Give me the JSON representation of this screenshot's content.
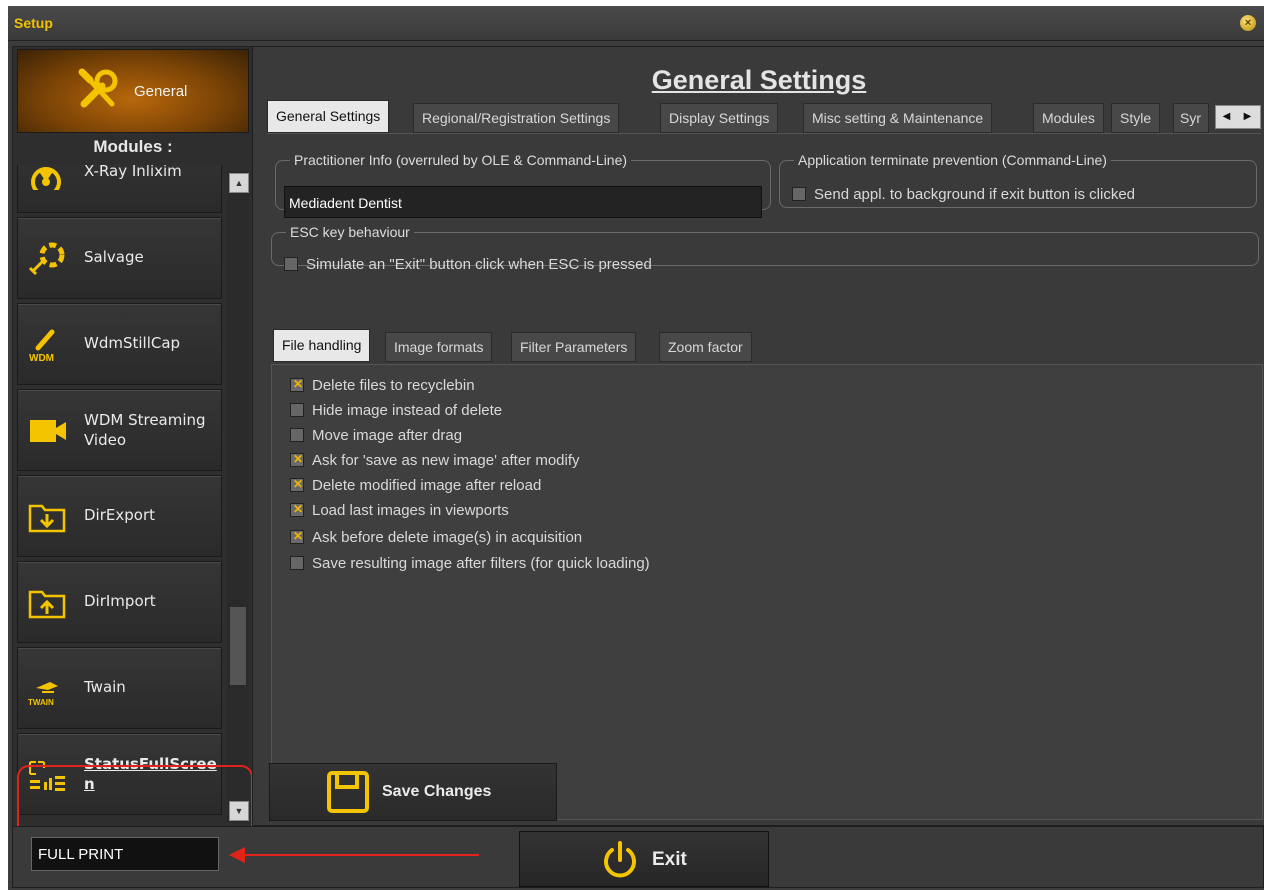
{
  "window": {
    "title": "Setup"
  },
  "sidebar": {
    "top_button": {
      "label": "General",
      "icon": "tools-icon"
    },
    "modules_header": "Modules :",
    "modules": [
      {
        "label": "X-Ray Inlixim",
        "icon": "radiation-icon"
      },
      {
        "label": "Salvage",
        "icon": "lifebuoy-icon"
      },
      {
        "label": "WdmStillCap",
        "icon": "wdm-camera-icon",
        "icon_text": "WDM"
      },
      {
        "label": "WDM Streaming Video",
        "icon": "video-camera-icon"
      },
      {
        "label": "DirExport",
        "icon": "folder-export-icon"
      },
      {
        "label": "DirImport",
        "icon": "folder-import-icon"
      },
      {
        "label": "Twain",
        "icon": "twain-icon",
        "icon_text": "TWAIN"
      },
      {
        "label": "StatusFullScreen",
        "label_lines": [
          "StatusFullScree",
          "n"
        ],
        "icon": "fullscreen-status-icon",
        "selected": true
      }
    ]
  },
  "main": {
    "title": "General Settings",
    "tabs": [
      "General Settings",
      "Regional/Registration Settings",
      "Display Settings",
      "Misc setting & Maintenance",
      "Modules",
      "Style",
      "Syr"
    ],
    "active_tab": "General Settings",
    "practitioner_group": {
      "legend": "Practitioner Info (overruled by OLE & Command-Line)",
      "value": "Mediadent Dentist"
    },
    "terminate_group": {
      "legend": "Application terminate prevention (Command-Line)",
      "checkbox": "Send appl. to background if exit button is clicked",
      "checked": false
    },
    "esc_group": {
      "legend": "ESC key behaviour",
      "checkbox": "Simulate an \"Exit\" button click when ESC is pressed",
      "checked": false
    },
    "inner_tabs": [
      "File handling",
      "Image formats",
      "Filter Parameters",
      "Zoom factor"
    ],
    "active_inner_tab": "File handling",
    "file_handling_options": [
      {
        "label": "Delete files to recyclebin",
        "checked": true
      },
      {
        "label": "Hide image instead of delete",
        "checked": false
      },
      {
        "label": "Move image after drag",
        "checked": false
      },
      {
        "label": "Ask for 'save as new image' after modify",
        "checked": true
      },
      {
        "label": "Delete modified image after reload",
        "checked": true
      },
      {
        "label": "Load last images in viewports",
        "checked": true
      },
      {
        "label": "Ask before delete image(s) in acquisition",
        "checked": true
      },
      {
        "label": "Save resulting image after filters (for quick loading)",
        "checked": false
      }
    ],
    "save_button": "Save Changes"
  },
  "bottom": {
    "status_field": "FULL PRINT",
    "exit_button": "Exit"
  },
  "colors": {
    "accent": "#f2c200",
    "annotation": "#e2231a",
    "background": "#3a3a3a"
  }
}
